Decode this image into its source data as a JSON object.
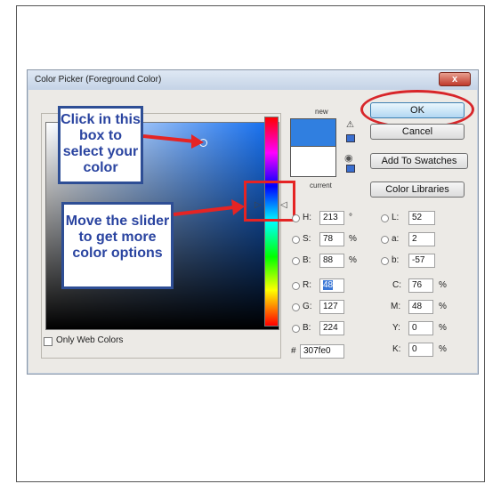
{
  "window": {
    "title": "Color Picker (Foreground Color)",
    "close_glyph": "x"
  },
  "buttons": {
    "ok": "OK",
    "cancel": "Cancel",
    "add_to_swatches": "Add To Swatches",
    "color_libraries": "Color Libraries"
  },
  "swatch": {
    "new_label": "new",
    "current_label": "current",
    "new_color": "#307fe0",
    "current_color": "#ffffff"
  },
  "hsb": {
    "h_label": "H:",
    "h_value": "213",
    "h_unit": "°",
    "s_label": "S:",
    "s_value": "78",
    "s_unit": "%",
    "b_label": "B:",
    "b_value": "88",
    "b_unit": "%"
  },
  "rgb": {
    "r_label": "R:",
    "r_value": "48",
    "g_label": "G:",
    "g_value": "127",
    "b_label": "B:",
    "b_value": "224"
  },
  "hex": {
    "label": "#",
    "value": "307fe0"
  },
  "lab": {
    "l_label": "L:",
    "l_value": "52",
    "a_label": "a:",
    "a_value": "2",
    "b_label": "b:",
    "b_value": "-57"
  },
  "cmyk": {
    "c_label": "C:",
    "c_value": "76",
    "c_unit": "%",
    "m_label": "M:",
    "m_value": "48",
    "m_unit": "%",
    "y_label": "Y:",
    "y_value": "0",
    "y_unit": "%",
    "k_label": "K:",
    "k_value": "0",
    "k_unit": "%"
  },
  "options": {
    "only_web_colors": "Only Web Colors"
  },
  "annotations": {
    "callout_box": "Click in this box to select your color",
    "callout_slider": "Move the slider to get more color options"
  },
  "colors": {
    "accent": "#307fe0",
    "annotation_red": "#e52424",
    "callout_blue": "#2e4e95"
  }
}
